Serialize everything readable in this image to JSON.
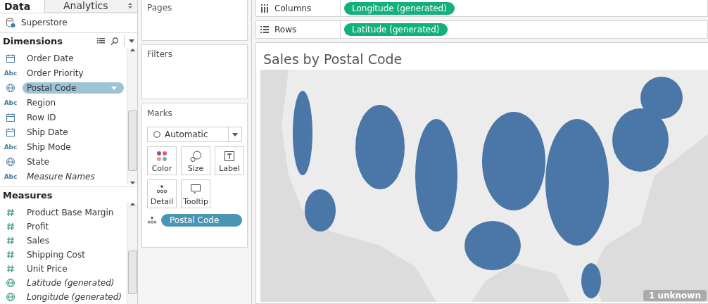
{
  "data_pane": {
    "tabs": [
      {
        "label": "Data",
        "selected": true
      },
      {
        "label": "Analytics",
        "selected": false
      }
    ],
    "data_source": "Superstore",
    "dimensions": {
      "title": "Dimensions",
      "items": [
        {
          "label": "Order Date",
          "kind": "date",
          "italic": false,
          "selected": false
        },
        {
          "label": "Order Priority",
          "kind": "text",
          "type_label": "Abc",
          "italic": false,
          "selected": false
        },
        {
          "label": "Postal Code",
          "kind": "geo",
          "italic": false,
          "selected": true
        },
        {
          "label": "Region",
          "kind": "text",
          "type_label": "Abc",
          "italic": false,
          "selected": false
        },
        {
          "label": "Row ID",
          "kind": "date",
          "italic": false,
          "selected": false
        },
        {
          "label": "Ship Date",
          "kind": "date",
          "italic": false,
          "selected": false
        },
        {
          "label": "Ship Mode",
          "kind": "text",
          "type_label": "Abc",
          "italic": false,
          "selected": false
        },
        {
          "label": "State",
          "kind": "geo",
          "italic": false,
          "selected": false
        },
        {
          "label": "Measure Names",
          "kind": "text",
          "type_label": "Abc",
          "italic": true,
          "selected": false
        }
      ]
    },
    "measures": {
      "title": "Measures",
      "items": [
        {
          "label": "Product Base Margin",
          "kind": "number",
          "italic": false,
          "selected": false
        },
        {
          "label": "Profit",
          "kind": "number",
          "italic": false,
          "selected": false
        },
        {
          "label": "Sales",
          "kind": "number",
          "italic": false,
          "selected": false
        },
        {
          "label": "Shipping Cost",
          "kind": "number",
          "italic": false,
          "selected": false
        },
        {
          "label": "Unit Price",
          "kind": "number",
          "italic": false,
          "selected": false
        },
        {
          "label": "Latitude (generated)",
          "kind": "geo",
          "italic": true,
          "selected": false
        },
        {
          "label": "Longitude (generated)",
          "kind": "geo",
          "italic": true,
          "selected": false
        }
      ]
    }
  },
  "pages": {
    "title": "Pages"
  },
  "filters": {
    "title": "Filters"
  },
  "marks": {
    "title": "Marks",
    "mark_type": "Automatic",
    "cards": [
      {
        "label": "Color",
        "kind": "color"
      },
      {
        "label": "Size",
        "kind": "size"
      },
      {
        "label": "Label",
        "kind": "label"
      },
      {
        "label": "Detail",
        "kind": "detail"
      },
      {
        "label": "Tooltip",
        "kind": "tooltip"
      }
    ],
    "pills": [
      {
        "label": "Postal Code",
        "kind": "detail"
      }
    ]
  },
  "shelves": [
    {
      "label": "Columns",
      "kind": "columns",
      "pill": "Longitude (generated)"
    },
    {
      "label": "Rows",
      "kind": "rows",
      "pill": "Latitude (generated)"
    }
  ],
  "sheet": {
    "title": "Sales by Postal Code",
    "badge": "1 unknown"
  }
}
